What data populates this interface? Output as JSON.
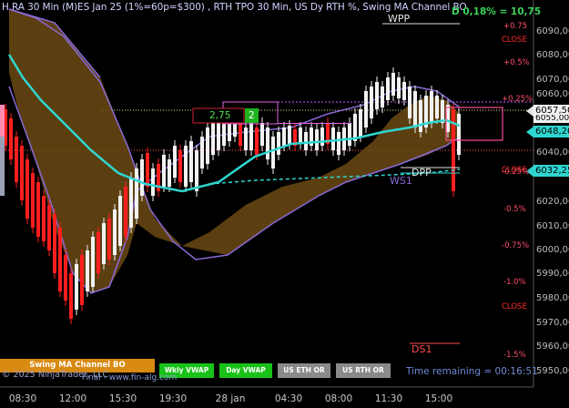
{
  "header": {
    "title": "H RA 30 Min (M)ES Jan 25 (1%=60p=$300) , RTH TPO 30 Min, US Dy RTH %, Swing MA Channel BO",
    "change_readout": "D 0,18% = 10,75"
  },
  "levels": {
    "wpp": "WPP",
    "dpp": "DPP",
    "ws1": "WS1",
    "ds1": "DS1"
  },
  "percent_labels": [
    {
      "text": "+0.75",
      "color": "#ff4d6a"
    },
    {
      "text": "CLOSE",
      "color": "#ff2a2a"
    },
    {
      "text": "+0.5%",
      "color": "#ff4d6a"
    },
    {
      "text": "+0.25%",
      "color": "#ff4d6a"
    },
    {
      "text": "CLOSE",
      "color": "#ff2a2a"
    },
    {
      "text": "-0.25%",
      "color": "#ff4d6a"
    },
    {
      "text": "-0.5%",
      "color": "#ff4d6a"
    },
    {
      "text": "-0.75%",
      "color": "#ff4d6a"
    },
    {
      "text": "-1.0%",
      "color": "#ff4d6a"
    },
    {
      "text": "CLOSE",
      "color": "#ff2a2a"
    },
    {
      "text": "-1.5%",
      "color": "#ff4d6a"
    }
  ],
  "price_axis": [
    "6090,00",
    "6080,00",
    "6070,00",
    "6060,00",
    "6050,00",
    "6040,00",
    "6030,00",
    "6020,00",
    "6010,00",
    "6000,00",
    "5990,00",
    "5980,00",
    "5970,00",
    "5960,00",
    "5950,00"
  ],
  "price_boxes": {
    "top": "6057,50",
    "behind": "6055,00",
    "cyan": "6048,20",
    "ma": "6032,25"
  },
  "channel_readout": {
    "left": "2,75",
    "right": "2"
  },
  "time_axis": [
    "08:30",
    "12:00",
    "15:30",
    "19:30",
    "28 jan",
    "04:30",
    "08:00",
    "11:30",
    "15:00"
  ],
  "buttons": {
    "swing": "Swing MA Channel BO",
    "wkly_vwap": "Wkly VWAP",
    "day_vwap": "Day VWAP",
    "us_eth_or": "US ETH OR",
    "us_rth_or": "US RTH OR"
  },
  "footer": {
    "copyright": "© 2025 NinjaTrader, LLC",
    "final": "Final - www.fin-alg.com",
    "time_remaining": "Time remaining = 00:16:51"
  },
  "colors": {
    "background": "#000000",
    "channel_fill": "#6b4a14",
    "channel_border": "#8a6ad6",
    "ma_line": "#2fd6d0",
    "up_candle": "#f2f2f2",
    "down_candle": "#ff1e1e",
    "button_orange": "#d98a12",
    "button_green": "#19c219",
    "button_gray": "#8a8a8a"
  }
}
